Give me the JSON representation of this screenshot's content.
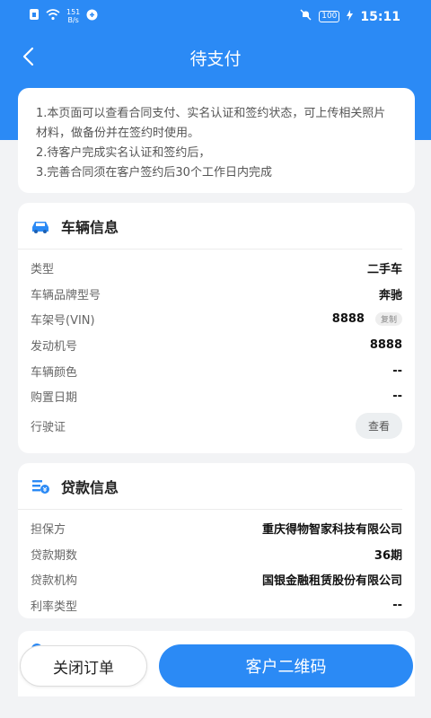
{
  "status": {
    "net_speed_value": "151",
    "net_speed_unit": "B/s",
    "battery": "100",
    "time": "15:11"
  },
  "nav": {
    "title": "待支付"
  },
  "notice": {
    "line1": "1.本页面可以查看合同支付、实名认证和签约状态，可上传相关照片材料，做备份并在签约时使用。",
    "line2": "2.待客户完成实名认证和签约后，",
    "line3": "3.完善合同须在客户签约后30个工作日内完成"
  },
  "vehicle": {
    "title": "车辆信息",
    "rows": [
      {
        "label": "类型",
        "value": "二手车"
      },
      {
        "label": "车辆品牌型号",
        "value": "奔驰"
      },
      {
        "label": "车架号(VIN)",
        "value": "8888",
        "tag": "复制"
      },
      {
        "label": "发动机号",
        "value": "8888"
      },
      {
        "label": "车辆颜色",
        "value": "--"
      },
      {
        "label": "购置日期",
        "value": "--"
      },
      {
        "label": "行驶证",
        "button": "查看"
      }
    ]
  },
  "loan": {
    "title": "贷款信息",
    "rows": [
      {
        "label": "担保方",
        "value": "重庆得物智家科技有限公司"
      },
      {
        "label": "贷款期数",
        "value": "36期"
      },
      {
        "label": "贷款机构",
        "value": "国银金融租赁股份有限公司"
      },
      {
        "label": "利率类型",
        "value": "--"
      }
    ]
  },
  "actions": {
    "close_order": "关闭订单",
    "customer_qr": "客户二维码"
  },
  "colors": {
    "primary": "#2b8af5",
    "background": "#f2f3f5"
  }
}
